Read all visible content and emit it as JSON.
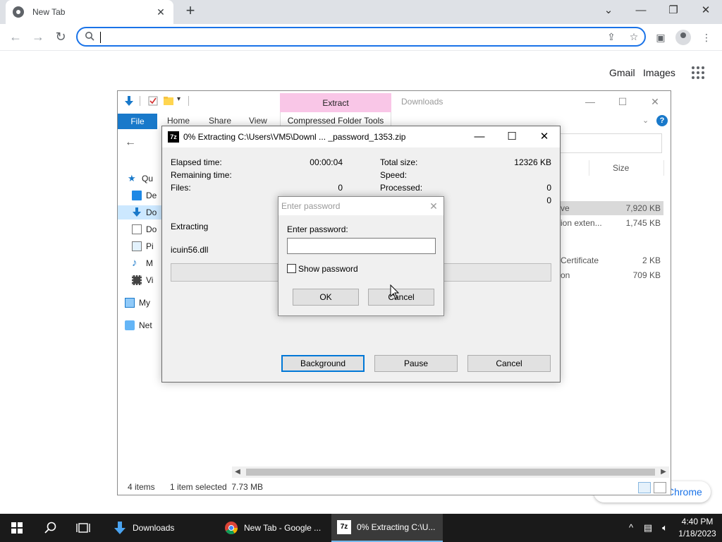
{
  "chrome": {
    "tab_title": "New Tab",
    "tab_close": "✕",
    "new_tab": "+",
    "omnibox_value": "",
    "links": {
      "gmail": "Gmail",
      "images": "Images"
    },
    "shortcut_label": "Chrome"
  },
  "explorer": {
    "title": "Downloads",
    "extract_tab": "Extract",
    "compressed_tools": "Compressed Folder Tools",
    "ribbon_tabs": [
      "File",
      "Home",
      "Share",
      "View"
    ],
    "column_size": "Size",
    "nav_items": [
      "Qu",
      "De",
      "Do",
      "Do",
      "Pi",
      "M",
      "Vi",
      "My",
      "Net"
    ],
    "files": [
      {
        "name": "ve",
        "size": "7,920 KB"
      },
      {
        "name": "ion exten...",
        "size": "1,745 KB"
      },
      {
        "name": "Certificate",
        "size": "2 KB"
      },
      {
        "name": "on",
        "size": "709 KB"
      }
    ],
    "status_items": "4 items",
    "status_selected": "1 item selected  7.73 MB"
  },
  "zip": {
    "title": "0% Extracting C:\\Users\\VM5\\Downl ... _password_1353.zip",
    "elapsed_label": "Elapsed time:",
    "elapsed_value": "00:00:04",
    "remaining_label": "Remaining time:",
    "files_label": "Files:",
    "files_value": "0",
    "total_label": "Total size:",
    "total_value": "12326 KB",
    "speed_label": "Speed:",
    "processed_label": "Processed:",
    "processed_value": "0",
    "extra_value": "0",
    "extracting_label": "Extracting",
    "current_file": "icuin56.dll",
    "progress_percent": 0,
    "buttons": {
      "background": "Background",
      "pause": "Pause",
      "cancel": "Cancel"
    }
  },
  "password_dialog": {
    "title": "Enter password",
    "label": "Enter password:",
    "value": "",
    "show_password": "Show password",
    "show_password_checked": false,
    "ok": "OK",
    "cancel": "Cancel"
  },
  "taskbar": {
    "items": [
      "Downloads",
      "New Tab - Google ...",
      "0% Extracting C:\\U..."
    ],
    "time": "4:40 PM",
    "date": "1/18/2023"
  }
}
